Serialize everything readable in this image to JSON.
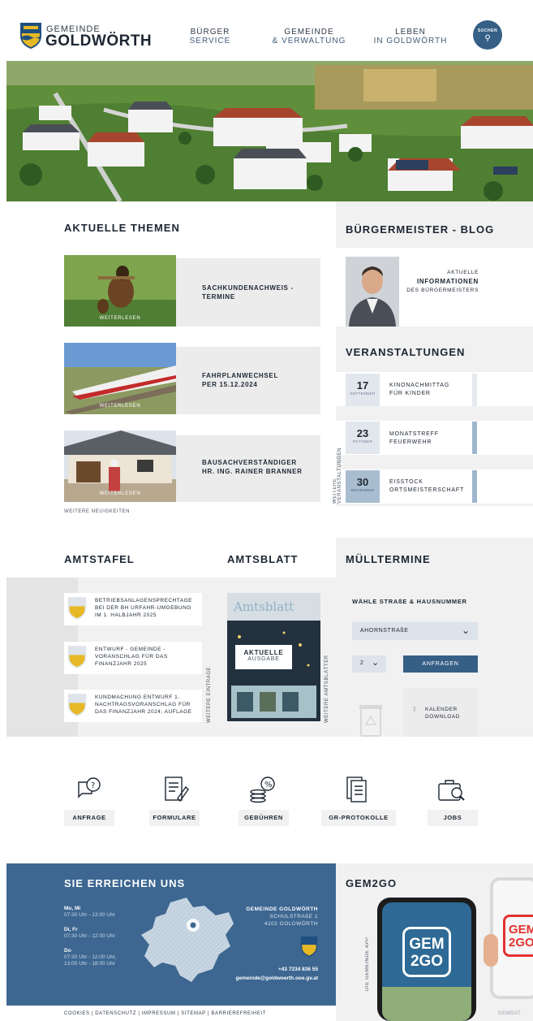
{
  "header": {
    "logo_small": "GEMEINDE",
    "logo_big": "GOLDWÖRTH",
    "nav": [
      {
        "l1": "BÜRGER",
        "l2": "SERVICE"
      },
      {
        "l1": "GEMEINDE",
        "l2": "& VERWALTUNG"
      },
      {
        "l1": "LEBEN",
        "l2": "IN GOLDWÖRTH"
      }
    ],
    "search_label": "SUCHEN"
  },
  "news": {
    "title": "AKTUELLE THEMEN",
    "items": [
      {
        "title_l1": "SACHKUNDENACHWEIS -",
        "title_l2": "TERMINE",
        "more": "WEITERLESEN"
      },
      {
        "title_l1": "FAHRPLANWECHSEL",
        "title_l2": "PER 15.12.2024",
        "more": "WEITERLESEN"
      },
      {
        "title_l1": "BAUSACHVERSTÄNDIGER",
        "title_l2": "HR. ING. RAINER BRANNER",
        "more": "WEITERLESEN"
      }
    ],
    "more_news": "WEITERE NEUIGKEITEN"
  },
  "blog": {
    "title": "BÜRGERMEISTER - BLOG",
    "l1": "AKTUELLE",
    "l2": "INFORMATIONEN",
    "l3": "DES BÜRGERMEISTERS"
  },
  "events": {
    "title": "VERANSTALTUNGEN",
    "more": "WEITERE VERANSTALTUNGEN",
    "items": [
      {
        "day": "17",
        "month": "SEPTEMBER",
        "t1": "KINONACHMITTAG",
        "t2": "FÜR KINDER"
      },
      {
        "day": "23",
        "month": "OKTOBER",
        "t1": "MONATSTREFF",
        "t2": "FEUERWEHR"
      },
      {
        "day": "30",
        "month": "NOVEMBER",
        "t1": "EISSTOCK",
        "t2": "ORTSMEISTERSCHAFT"
      }
    ]
  },
  "amtstafel": {
    "title": "AMTSTAFEL",
    "more": "WEITERE EINTRÄGE",
    "items": [
      {
        "l1": "BETRIEBSANLAGENSPRECHTAGE",
        "l2": "BEI DER BH URFAHR-UMGEBUNG",
        "l3": "IM 1. HALBJAHR 2025"
      },
      {
        "l1": "ENTWURF - GEMEINDE -",
        "l2": "VORANSCHLAG FÜR DAS",
        "l3": "FINANZJAHR 2025"
      },
      {
        "l1": "KUNDMACHUNG ENTWURF 1.",
        "l2": "NACHTRAGSVORANSCHLAG FÜR",
        "l3": "DAS FINANZJAHR 2024; AUFLAGE"
      }
    ]
  },
  "amtsblatt": {
    "title": "AMTSBLATT",
    "cover_title": "Amtsblatt",
    "l1": "AKTUELLE",
    "l2": "AUSGABE",
    "more": "WEITERE AMTSBLÄTTER"
  },
  "muell": {
    "title": "MÜLLTERMINE",
    "label": "WÄHLE STRAßE & HAUSNUMMER",
    "street": "AHORNSTRAßE",
    "number": "2",
    "button": "ANFRAGEN",
    "cal_l1": "KALENDER",
    "cal_l2": "DOWNLOAD"
  },
  "quicklinks": [
    {
      "label": "ANFRAGE",
      "icon": "question-bubble-icon"
    },
    {
      "label": "FORMULARE",
      "icon": "form-icon"
    },
    {
      "label": "GEBÜHREN",
      "icon": "coins-icon"
    },
    {
      "label": "GR-PROTOKOLLE",
      "icon": "documents-icon"
    },
    {
      "label": "JOBS",
      "icon": "briefcase-search-icon"
    }
  ],
  "contact": {
    "title": "SIE ERREICHEN UNS",
    "hours": [
      {
        "days": "Mo, Mi",
        "times": [
          "07:30 Uhr - 13:00 Uhr"
        ]
      },
      {
        "days": "Di, Fr",
        "times": [
          "07:30 Uhr - 12:00 Uhr"
        ]
      },
      {
        "days": "Do",
        "times": [
          "07:30 Uhr - 12:00 Uhr,",
          "13:00 Uhr - 18:00 Uhr"
        ]
      }
    ],
    "org": "GEMEINDE GOLDWÖRTH",
    "street": "SCHULSTRAßE 1",
    "city": "4102 GOLDWÖRTH",
    "phone": "+43 7234 836 55",
    "email": "gemeinde@goldwoerth.ooe.gv.at"
  },
  "gem2go": {
    "title": "GEM2GO",
    "vertical": "DIE GEMEINDE APP",
    "logo_l1": "GEM",
    "logo_l2": "2GO",
    "corner": "GEMDAT"
  },
  "footer": {
    "links": [
      "COOKIES",
      "DATENSCHUTZ",
      "IMPRESSUM",
      "SITEMAP",
      "BARRIEREFREIHEIT"
    ]
  },
  "colors": {
    "accent_blue": "#3d6791",
    "dark_blue": "#365f86",
    "text_dark": "#1d2733",
    "grey_bg": "#f1f1f1"
  }
}
